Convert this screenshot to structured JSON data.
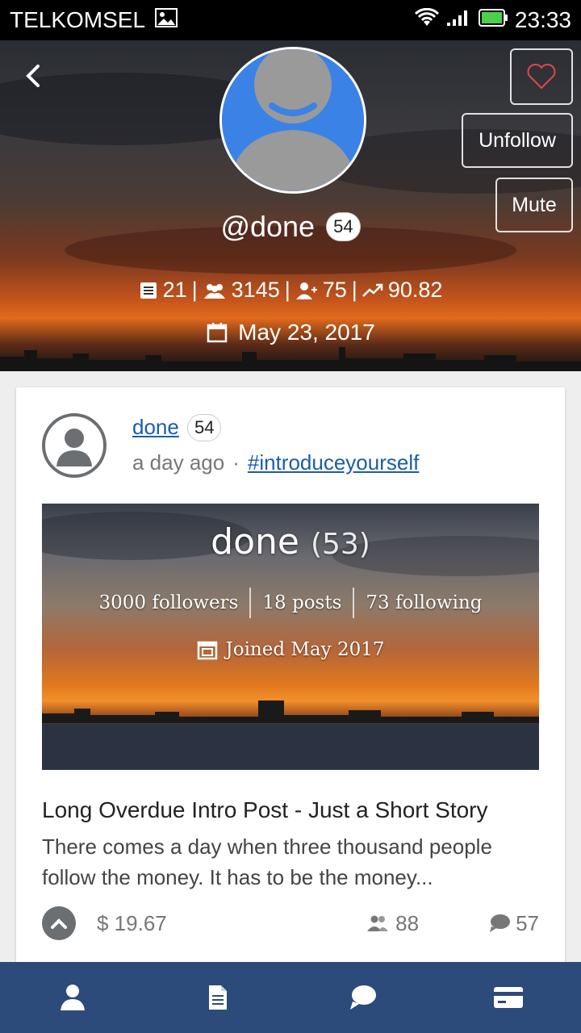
{
  "status_bar": {
    "carrier": "TELKOMSEL",
    "time": "23:33",
    "icons": [
      "image-icon",
      "wifi-icon",
      "signal-icon",
      "battery-icon"
    ]
  },
  "profile": {
    "handle": "@done",
    "reputation": "54",
    "stats": {
      "posts": "21",
      "followers": "3145",
      "following": "75",
      "voting_power": "90.82"
    },
    "joined_date": "May 23, 2017",
    "buttons": {
      "unfollow": "Unfollow",
      "mute": "Mute"
    }
  },
  "post": {
    "author": "done",
    "author_reputation": "54",
    "time_ago": "a day ago",
    "separator": "·",
    "tag": "#introduceyourself",
    "image": {
      "name": "done",
      "rep": "(53)",
      "followers": "3000 followers",
      "posts": "18 posts",
      "following": "73 following",
      "joined": "Joined May 2017"
    },
    "title": "Long Overdue Intro Post - Just a Short Story",
    "excerpt": "There comes a day when three thousand people follow the money. It has to be the money...",
    "payout": "$ 19.67",
    "voters": "88",
    "comments": "57"
  },
  "bottom_nav": [
    "profile-icon",
    "document-icon",
    "chat-icon",
    "wallet-icon"
  ],
  "colors": {
    "nav_bg": "#2c4a7a",
    "link": "#1a5ea8",
    "avatar_blue": "#3b82e6"
  }
}
